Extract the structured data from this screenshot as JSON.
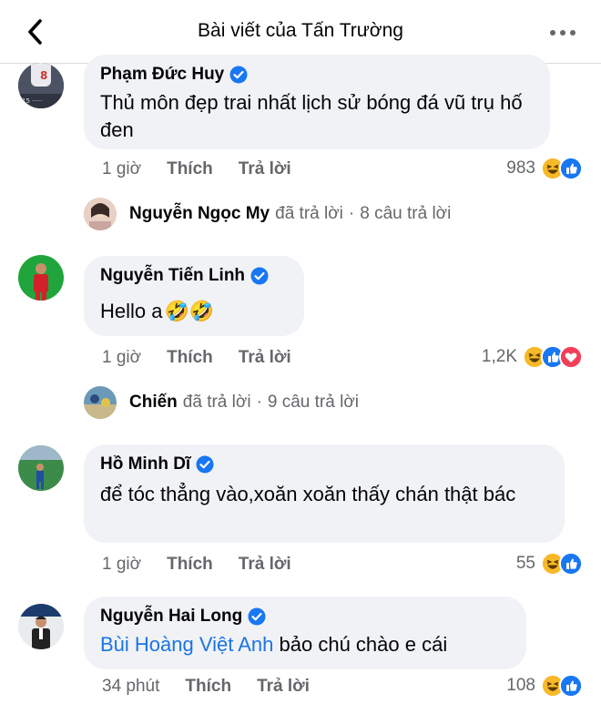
{
  "header": {
    "title": "Bài viết của Tấn Trường"
  },
  "comments": [
    {
      "author": "Phạm Đức Huy",
      "text": "Thủ môn đẹp trai nhất lịch sử bóng đá vũ trụ hố đen",
      "time": "1 giờ",
      "like_label": "Thích",
      "reply_label": "Trả lời",
      "reaction_count": "983",
      "reply_summary": {
        "name": "Nguyễn Ngọc My",
        "action": "đã trả lời",
        "count": "8 câu trả lời"
      }
    },
    {
      "author": "Nguyễn Tiến Linh",
      "text": "Hello a",
      "emojis": "🤣🤣",
      "time": "1 giờ",
      "like_label": "Thích",
      "reply_label": "Trả lời",
      "reaction_count": "1,2K",
      "reply_summary": {
        "name": "Chiến",
        "action": "đã trả lời",
        "count": "9 câu trả lời"
      }
    },
    {
      "author": "Hồ Minh Dĩ",
      "text": "để tóc thẳng vào,xoăn xoăn thấy chán thật bác",
      "time": "1 giờ",
      "like_label": "Thích",
      "reply_label": "Trả lời",
      "reaction_count": "55"
    },
    {
      "author": "Nguyễn Hai Long",
      "mention": "Bùi Hoàng Việt Anh",
      "text": " bảo chú chào e cái",
      "time": "34 phút",
      "like_label": "Thích",
      "reply_label": "Trả lời",
      "reaction_count": "108"
    }
  ],
  "icons": {
    "back": "back-arrow-icon",
    "more": "more-options-icon",
    "verified": "verified-badge-icon",
    "haha": "haha-reaction-icon",
    "like": "like-reaction-icon",
    "love": "love-reaction-icon"
  },
  "colors": {
    "link": "#1b74e4",
    "verified": "#1877f2",
    "bubble": "#f0f2f5",
    "love": "#f33e58",
    "haha": "#f7b928"
  }
}
